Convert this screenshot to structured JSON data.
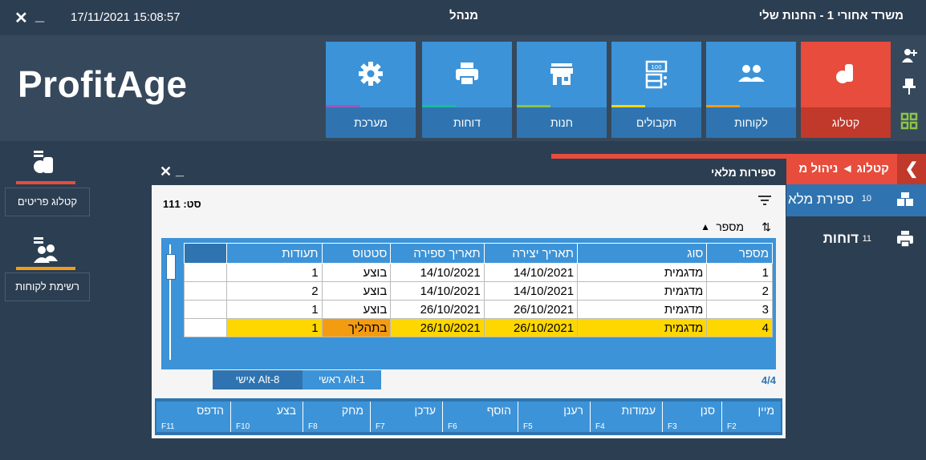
{
  "topbar": {
    "datetime": "17/11/2021 15:08:57",
    "title": "מנהל",
    "office": "משרד אחורי  1 - החנות שלי"
  },
  "logo": "ProfitAge",
  "tiles": [
    {
      "label": "קטלוג",
      "icon": "catalog-icon"
    },
    {
      "label": "לקוחות",
      "icon": "customers-icon"
    },
    {
      "label": "תקבולים",
      "icon": "receipts-icon"
    },
    {
      "label": "חנות",
      "icon": "store-icon"
    },
    {
      "label": "דוחות",
      "icon": "print-icon"
    },
    {
      "label": "מערכת",
      "icon": "gear-icon"
    }
  ],
  "sidebar": [
    {
      "label": "קטלוג פריטים",
      "icon": "catalog-items-icon"
    },
    {
      "label": "רשימת לקוחות",
      "icon": "customer-list-icon"
    }
  ],
  "breadcrumb": "קטלוג ◄ ניהול מ",
  "panel": [
    {
      "num": "10",
      "label": "ספירת מלאי"
    },
    {
      "num": "11",
      "label": "דוחות"
    }
  ],
  "dialog": {
    "title": "ספירות מלאי",
    "count_label": "סט: 111",
    "sort_label": "מספר",
    "table": {
      "headers": [
        "מספר",
        "סוג",
        "תאריך יצירה",
        "תאריך ספירה",
        "סטטוס",
        "תעודות"
      ],
      "rows": [
        [
          "1",
          "מדגמית",
          "14/10/2021",
          "14/10/2021",
          "בוצע",
          "1"
        ],
        [
          "2",
          "מדגמית",
          "14/10/2021",
          "14/10/2021",
          "בוצע",
          "2"
        ],
        [
          "3",
          "מדגמית",
          "26/10/2021",
          "26/10/2021",
          "בוצע",
          "1"
        ],
        [
          "4",
          "מדגמית",
          "26/10/2021",
          "26/10/2021",
          "בתהליך",
          "1"
        ]
      ]
    },
    "tabs": [
      "ראשי  Alt-1",
      "אישי  Alt-8"
    ],
    "page_count": "4/4",
    "fkeys": [
      {
        "label": "מיין",
        "key": "F2"
      },
      {
        "label": "סנן",
        "key": "F3"
      },
      {
        "label": "עמודות",
        "key": "F4"
      },
      {
        "label": "רענן",
        "key": "F5"
      },
      {
        "label": "הוסף",
        "key": "F6"
      },
      {
        "label": "עדכן",
        "key": "F7"
      },
      {
        "label": "מחק",
        "key": "F8"
      },
      {
        "label": "בצע",
        "key": "F10"
      },
      {
        "label": "הדפס",
        "key": "F11"
      }
    ]
  },
  "colors": {
    "bg": "#2c3e52",
    "blue": "#3c93d8",
    "red": "#e74c3c",
    "yellow": "#ffd700",
    "orange": "#f39c12"
  }
}
